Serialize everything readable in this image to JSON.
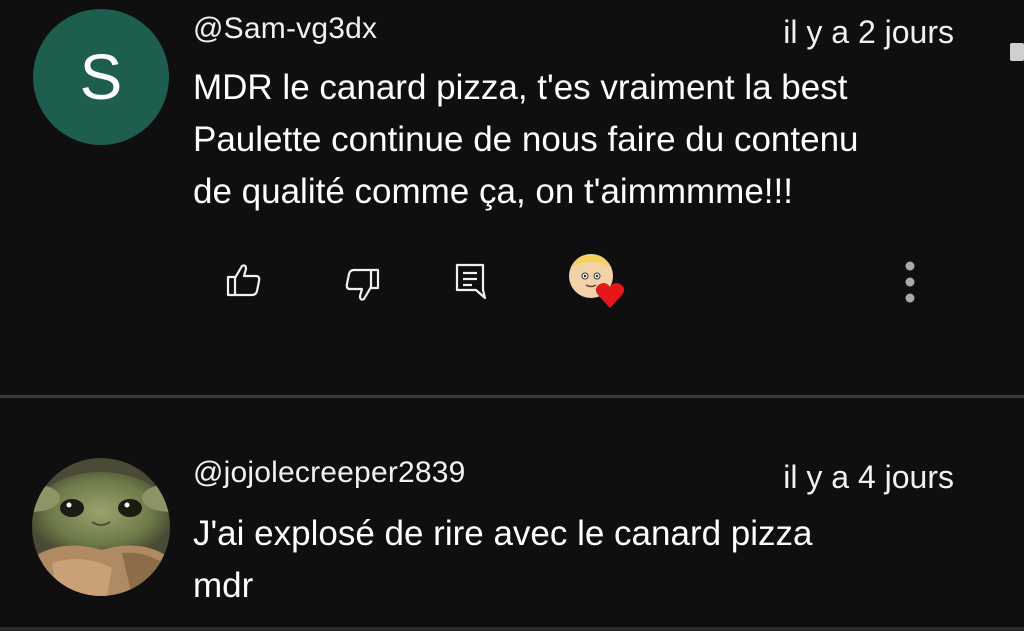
{
  "colors": {
    "background": "#0f0f0f",
    "text": "#f1f1f1",
    "avatar_green": "#1e5e4e",
    "heart_red": "#e5171b",
    "divider": "#3a3a3a"
  },
  "comments": [
    {
      "avatar_letter": "S",
      "author": "@Sam-vg3dx",
      "timestamp": "il y a 2 jours",
      "lines": [
        "MDR le canard pizza, t'es vraiment la best",
        "Paulette continue de nous faire du contenu",
        "de qualité comme ça, on t'aimmmme!!!"
      ],
      "actions": {
        "like_icon": "thumbs-up-icon",
        "dislike_icon": "thumbs-down-icon",
        "reply_icon": "reply-icon",
        "creator_heart_icon": "creator-heart-icon",
        "menu_icon": "more-vertical-icon"
      }
    },
    {
      "avatar_image": "baby-yoda-avatar",
      "author": "@jojolecreeper2839",
      "timestamp": "il y a 4 jours",
      "lines": [
        "J'ai explosé de rire avec le canard pizza",
        "mdr"
      ]
    }
  ]
}
